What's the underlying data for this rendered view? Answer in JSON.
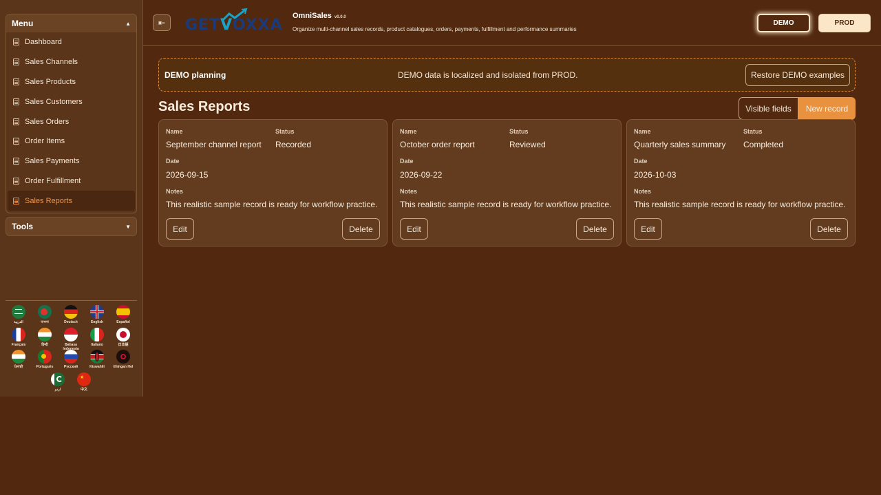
{
  "sidebar": {
    "menu_title": "Menu",
    "tools_title": "Tools",
    "items": [
      {
        "label": "Dashboard"
      },
      {
        "label": "Sales Channels"
      },
      {
        "label": "Sales Products"
      },
      {
        "label": "Sales Customers"
      },
      {
        "label": "Sales Orders"
      },
      {
        "label": "Order Items"
      },
      {
        "label": "Sales Payments"
      },
      {
        "label": "Order Fulfillment"
      },
      {
        "label": "Sales Reports",
        "active": true
      }
    ],
    "languages": [
      {
        "name": "العربية"
      },
      {
        "name": "বাংলা"
      },
      {
        "name": "Deutsch"
      },
      {
        "name": "English",
        "selected": true
      },
      {
        "name": "Español"
      },
      {
        "name": "Français"
      },
      {
        "name": "हिन्दी"
      },
      {
        "name": "Bahasa Indonesia"
      },
      {
        "name": "Italiano"
      },
      {
        "name": "日本語"
      },
      {
        "name": "ਪੰਜਾਬੀ"
      },
      {
        "name": "Português"
      },
      {
        "name": "Русский"
      },
      {
        "name": "Kiswahili"
      },
      {
        "name": "tlhIngan Hol"
      },
      {
        "name": "اردو"
      },
      {
        "name": "中文"
      }
    ]
  },
  "header": {
    "logo_text_left": "GET",
    "logo_text_v": "V",
    "logo_text_right": "OXXA",
    "app_name": "OmniSales",
    "version": "v0.0.0",
    "description": "Organize multi-channel sales records, product catalogues, orders, payments, fulfillment and performance summaries",
    "env_demo": "DEMO",
    "env_prod": "PROD"
  },
  "notice": {
    "title": "DEMO planning",
    "text": "DEMO data is localized and isolated from PROD.",
    "restore_label": "Restore DEMO examples"
  },
  "main": {
    "title": "Sales Reports",
    "visible_fields_label": "Visible fields",
    "new_record_label": "New record",
    "field_labels": {
      "name": "Name",
      "status": "Status",
      "date": "Date",
      "notes": "Notes"
    },
    "edit_label": "Edit",
    "delete_label": "Delete",
    "records": [
      {
        "name": "September channel report",
        "status": "Recorded",
        "date": "2026-09-15",
        "notes": "This realistic sample record is ready for workflow practice."
      },
      {
        "name": "October order report",
        "status": "Reviewed",
        "date": "2026-09-22",
        "notes": "This realistic sample record is ready for workflow practice."
      },
      {
        "name": "Quarterly sales summary",
        "status": "Completed",
        "date": "2026-10-03",
        "notes": "This realistic sample record is ready for workflow practice."
      }
    ]
  },
  "colors": {
    "background": "#52290f",
    "sidebar": "#5b3519",
    "card": "#633c1f",
    "accent": "#e8913f",
    "active_menu": "#f0964a"
  }
}
